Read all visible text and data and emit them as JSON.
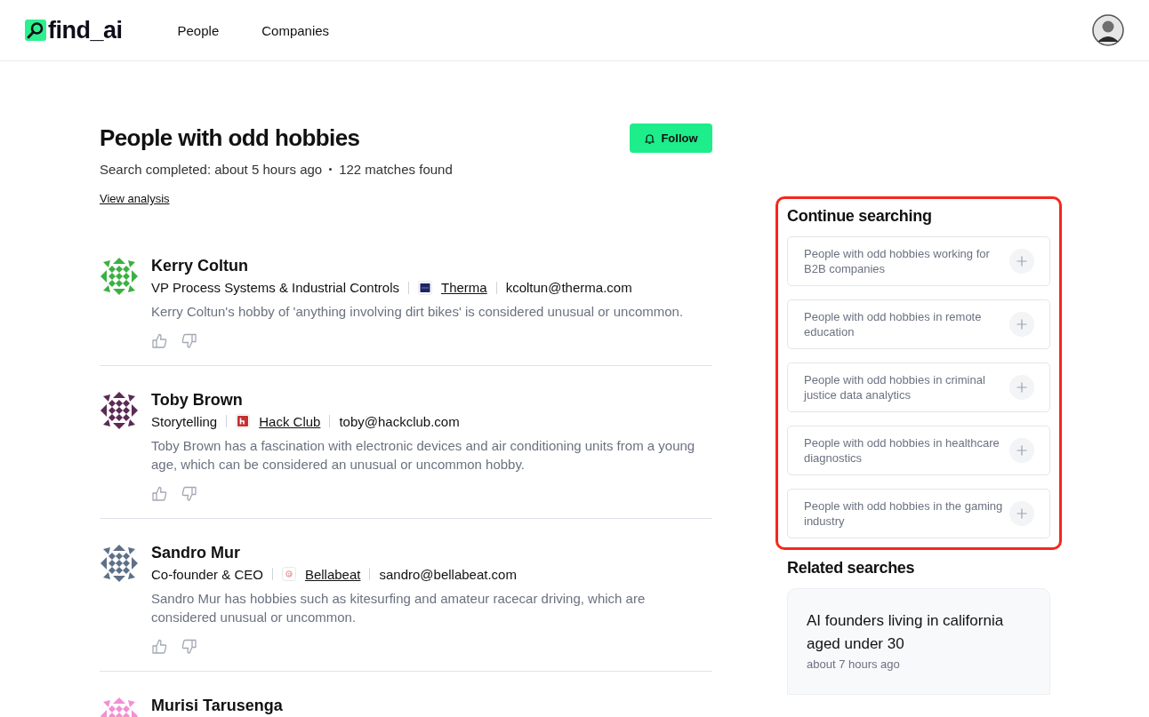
{
  "header": {
    "logo": "find_ai",
    "nav": [
      {
        "label": "People"
      },
      {
        "label": "Companies"
      }
    ]
  },
  "search": {
    "title": "People with odd hobbies",
    "follow_button": "Follow",
    "status": "Search completed: about 5 hours ago",
    "matches": "122 matches found",
    "analysis_link": "View analysis"
  },
  "people": [
    {
      "name": "Kerry Coltun",
      "role": "VP Process Systems & Industrial Controls",
      "company": "Therma",
      "company_logo": {
        "kind": "navy"
      },
      "email": "kcoltun@therma.com",
      "description": "Kerry Coltun's hobby of 'anything involving dirt bikes' is considered unusual or uncommon.",
      "color": "#3cb043"
    },
    {
      "name": "Toby Brown",
      "role": "Storytelling",
      "company": "Hack Club",
      "company_logo": {
        "kind": "red"
      },
      "email": "toby@hackclub.com",
      "description": "Toby Brown has a fascination with electronic devices and air conditioning units from a young age, which can be considered an unusual or uncommon hobby.",
      "color": "#5b2a55"
    },
    {
      "name": "Sandro Mur",
      "role": "Co-founder & CEO",
      "company": "Bellabeat",
      "company_logo": {
        "kind": "swirl"
      },
      "email": "sandro@bellabeat.com",
      "description": "Sandro Mur has hobbies such as kitesurfing and amateur racecar driving, which are considered unusual or uncommon.",
      "color": "#5e7088"
    },
    {
      "name": "Murisi Tarusenga",
      "color": "#f38fd3"
    }
  ],
  "continue_searching": {
    "title": "Continue searching",
    "highlighted": true,
    "suggestions": [
      {
        "label": "People with odd hobbies working for B2B companies"
      },
      {
        "label": "People with odd hobbies in remote education"
      },
      {
        "label": "People with odd hobbies in criminal justice data analytics"
      },
      {
        "label": "People with odd hobbies in healthcare diagnostics"
      },
      {
        "label": "People with odd hobbies in the gaming industry"
      }
    ]
  },
  "related_searches": {
    "title": "Related searches",
    "items": [
      {
        "query": "AI founders living in california aged under 30",
        "time": "about 7 hours ago"
      }
    ]
  }
}
